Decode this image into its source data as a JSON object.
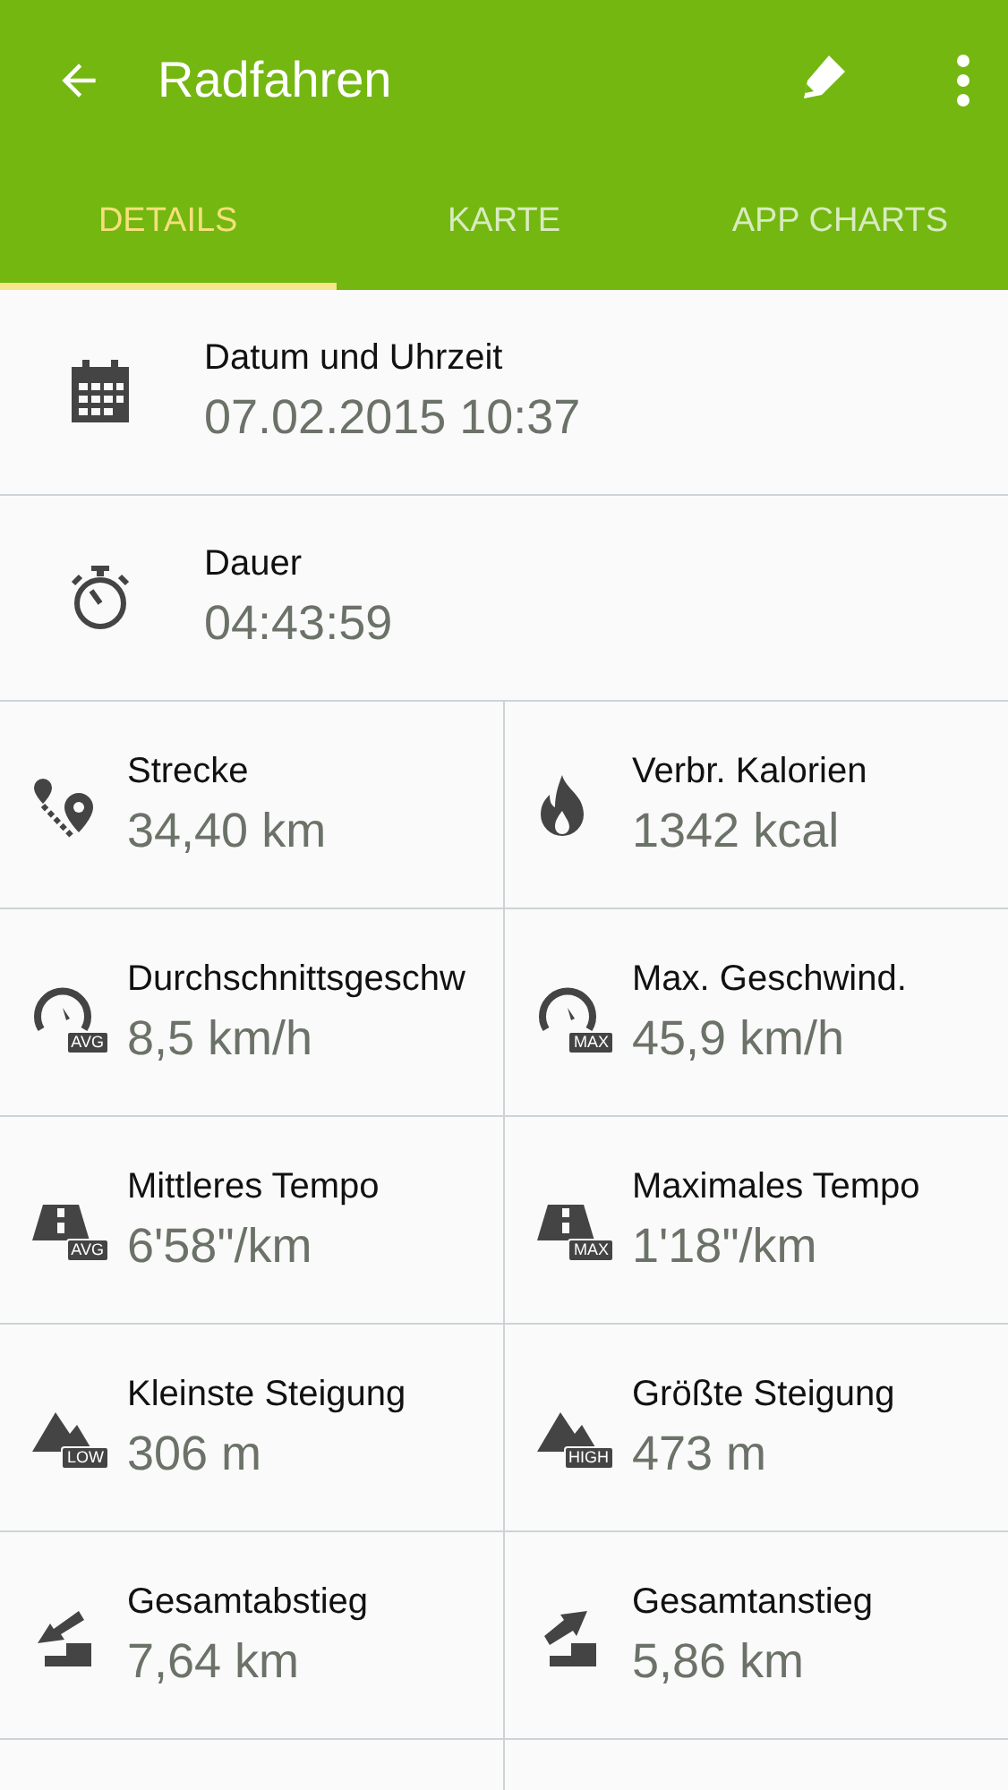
{
  "toolbar": {
    "title": "Radfahren"
  },
  "tabs": [
    {
      "label": "DETAILS",
      "selected": true
    },
    {
      "label": "KARTE",
      "selected": false
    },
    {
      "label": "APP CHARTS",
      "selected": false
    }
  ],
  "details": [
    {
      "kind": "calendar",
      "label": "Datum und Uhrzeit",
      "value": "07.02.2015 10:37"
    },
    {
      "kind": "stopwatch",
      "label": "Dauer",
      "value": "04:43:59"
    }
  ],
  "stats": [
    {
      "kind": "route",
      "label": "Strecke",
      "value": "34,40 km"
    },
    {
      "kind": "flame",
      "label": "Verbr. Kalorien",
      "value": "1342 kcal"
    },
    {
      "kind": "gauge",
      "badge": "AVG",
      "label": "Durchschnittsgeschw",
      "value": "8,5 km/h"
    },
    {
      "kind": "gauge",
      "badge": "MAX",
      "label": "Max. Geschwind.",
      "value": "45,9 km/h"
    },
    {
      "kind": "road",
      "badge": "AVG",
      "label": "Mittleres Tempo",
      "value": "6'58\"/km"
    },
    {
      "kind": "road",
      "badge": "MAX",
      "label": "Maximales Tempo",
      "value": "1'18\"/km"
    },
    {
      "kind": "mountain",
      "badge": "LOW",
      "label": "Kleinste Steigung",
      "value": "306 m"
    },
    {
      "kind": "mountain",
      "badge": "HIGH",
      "label": "Größte Steigung",
      "value": "473 m"
    },
    {
      "kind": "descent",
      "label": "Gesamtabstieg",
      "value": "7,64 km"
    },
    {
      "kind": "ascent",
      "label": "Gesamtanstieg",
      "value": "5,86 km"
    }
  ]
}
